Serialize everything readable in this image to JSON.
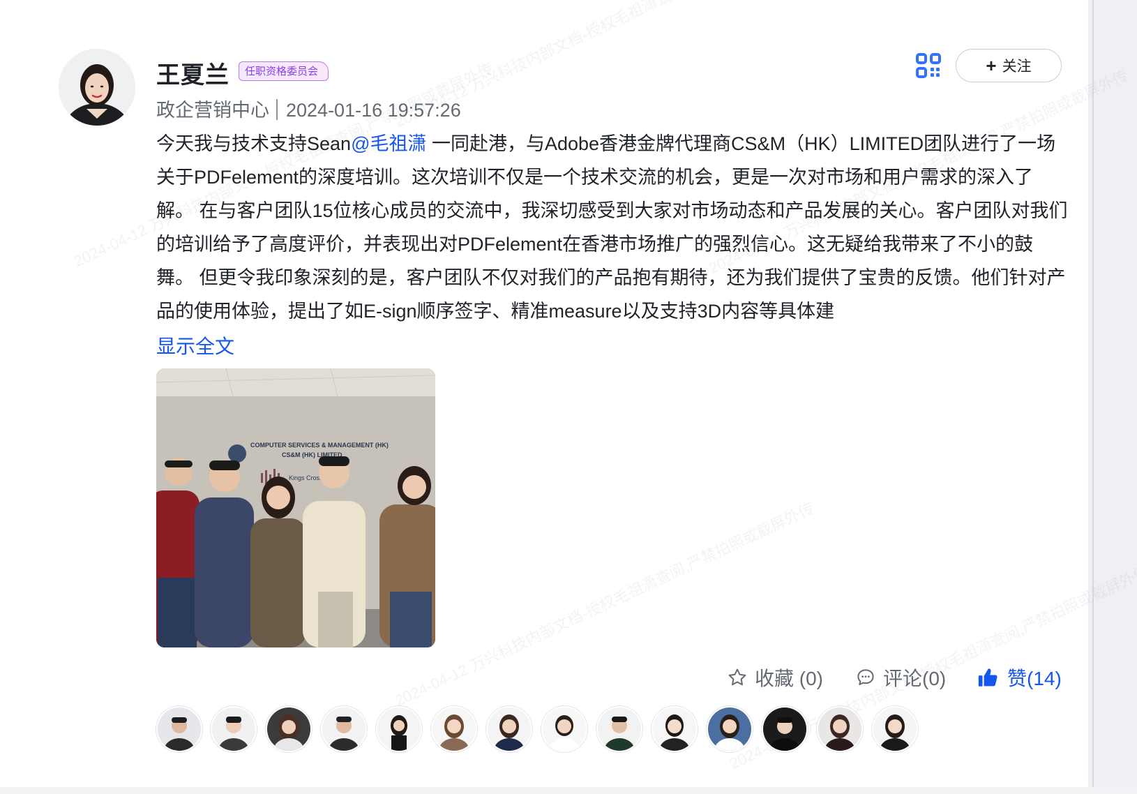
{
  "author": {
    "name": "王夏兰",
    "badge": "任职资格委员会",
    "department": "政企营销中心",
    "timestamp": "2024-01-16 19:57:26"
  },
  "toolbar": {
    "follow_label": "关注"
  },
  "post": {
    "text_before_mention": "今天我与技术支持Sean",
    "mention": "@毛祖潇",
    "text_after_mention": " 一同赴港，与Adobe香港金牌代理商CS&M（HK）LIMITED团队进行了一场关于PDFelement的深度培训。这次培训不仅是一个技术交流的机会，更是一次对市场和用户需求的深入了解。 在与客户团队15位核心成员的交流中，我深切感受到大家对市场动态和产品发展的关心。客户团队对我们的培训给予了高度评价，并表现出对PDFelement在香港市场推广的强烈信心。这无疑给我带来了不小的鼓舞。 但更令我印象深刻的是，客户团队不仅对我们的产品抱有期待，还为我们提供了宝贵的反馈。他们针对产品的使用体验，提出了如E-sign顺序签字、精准measure以及支持3D内容等具体建",
    "show_all": "显示全文"
  },
  "photo": {
    "sign_line1": "COMPUTER SERVICES & MANAGEMENT (HK)",
    "sign_line2": "CS&M (HK) LIMITED",
    "sign_line3": "Kings Cross (HK)"
  },
  "actions": {
    "favorite": "收藏 (0)",
    "comment": "评论(0)",
    "like": "赞(14)"
  },
  "watermark": {
    "text": "2024-04-12 万兴科技内部文档-授权毛祖潇查阅,严禁拍照或截屏外传"
  },
  "colors": {
    "accent": "#1456f0",
    "badge": "#8a3ff5",
    "meta": "#646a73"
  }
}
